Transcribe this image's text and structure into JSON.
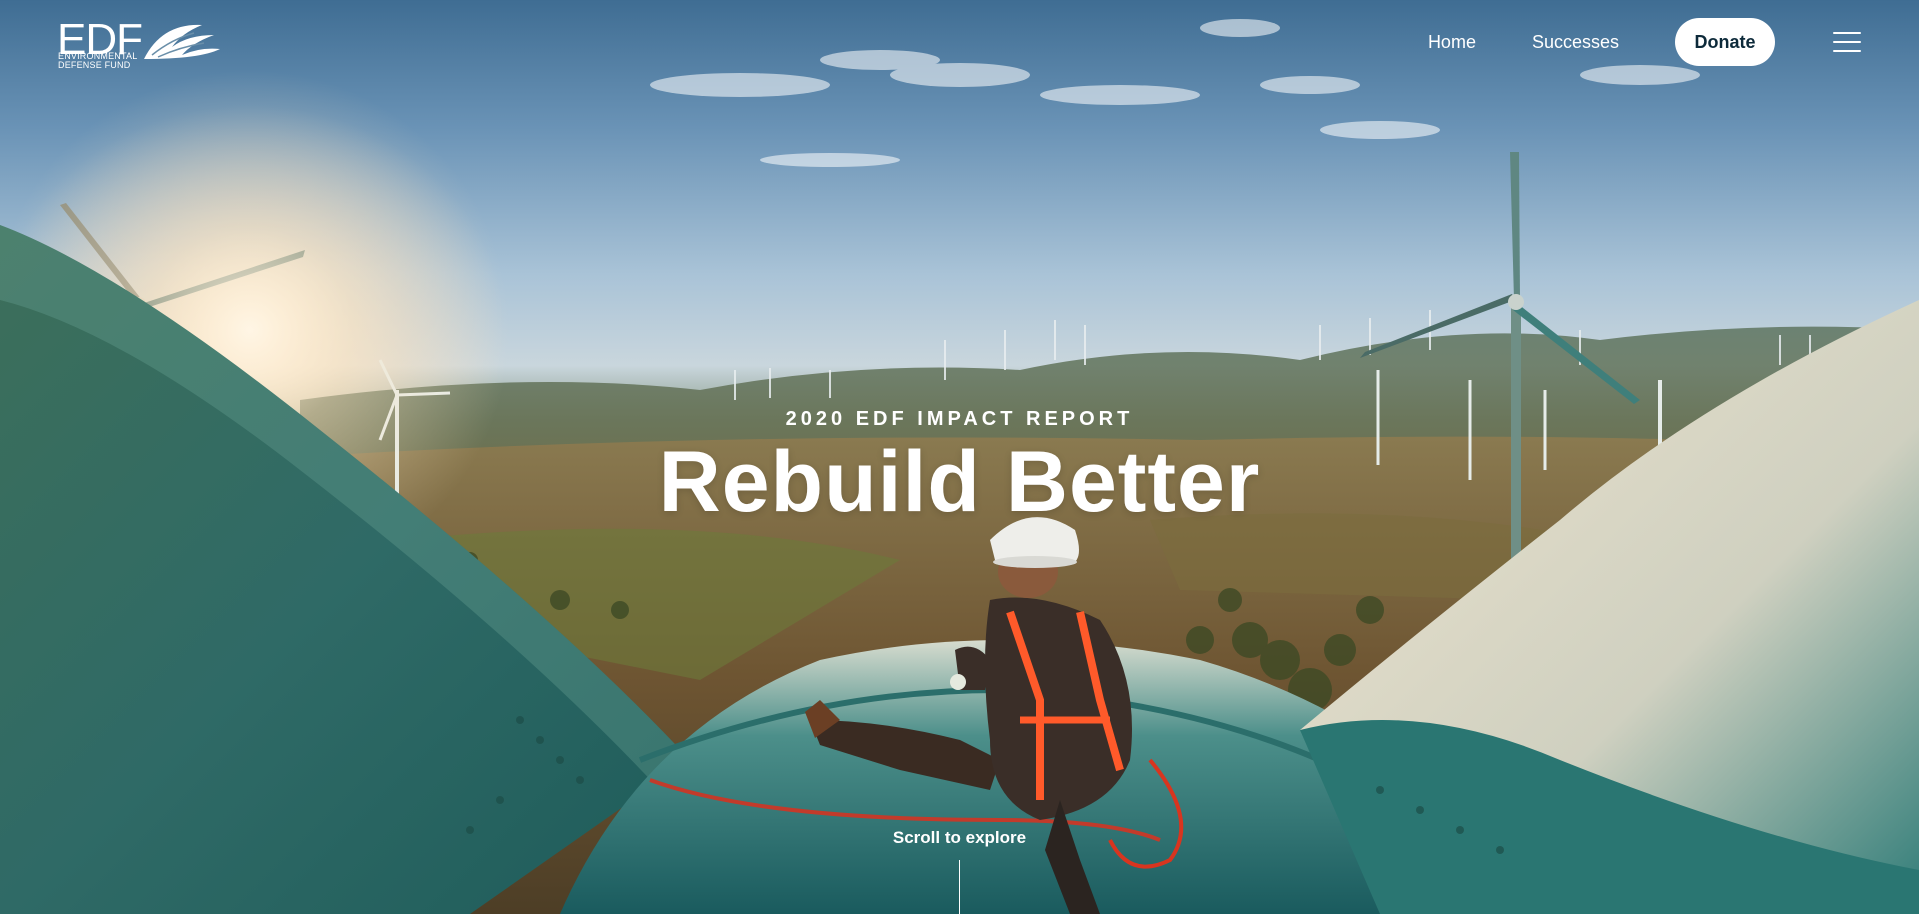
{
  "logo": {
    "word": "EDF",
    "line1": "ENVIRONMENTAL",
    "line2": "DEFENSE FUND",
    "icon": "leaf-wing-icon"
  },
  "nav": {
    "home": "Home",
    "successes": "Successes",
    "donate": "Donate",
    "menu_icon": "hamburger-menu-icon"
  },
  "hero": {
    "eyebrow": "2020 EDF IMPACT REPORT",
    "title": "Rebuild Better",
    "scroll": "Scroll to explore"
  }
}
